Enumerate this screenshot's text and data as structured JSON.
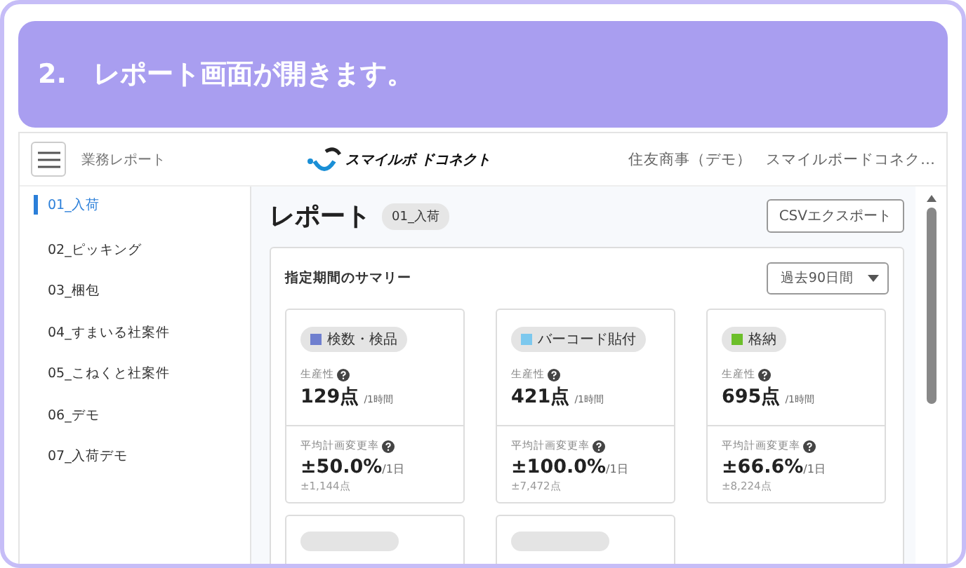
{
  "banner": {
    "text": "2.　レポート画面が開きます。"
  },
  "header": {
    "title": "業務レポート",
    "logo_text": "スマイルボ ドコネクト",
    "company": "住友商事（デモ）",
    "user": "スマイルボードコネク…"
  },
  "sidebar": {
    "items": [
      {
        "label": "01_入荷",
        "selected": true
      },
      {
        "label": "02_ピッキング",
        "selected": false
      },
      {
        "label": "03_梱包",
        "selected": false
      },
      {
        "label": "04_すまいる社案件",
        "selected": false
      },
      {
        "label": "05_こねくと社案件",
        "selected": false
      },
      {
        "label": "06_デモ",
        "selected": false
      },
      {
        "label": "07_入荷デモ",
        "selected": false
      }
    ]
  },
  "report": {
    "title": "レポート",
    "tag": "01_入荷",
    "export_button": "CSVエクスポート"
  },
  "summary": {
    "title": "指定期間のサマリー",
    "period": "過去90日間",
    "cards": [
      {
        "name": "検数・検品",
        "color": "#6f7fcf",
        "productivity_label": "生産性",
        "productivity": "129点",
        "productivity_unit": "/1時間",
        "rate_label": "平均計画変更率",
        "rate": "±50.0%",
        "rate_unit": "/1日",
        "note": "±1,144点"
      },
      {
        "name": "バーコード貼付",
        "color": "#7cc8ee",
        "productivity_label": "生産性",
        "productivity": "421点",
        "productivity_unit": "/1時間",
        "rate_label": "平均計画変更率",
        "rate": "±100.0%",
        "rate_unit": "/1日",
        "note": "±7,472点"
      },
      {
        "name": "格納",
        "color": "#6cbf2a",
        "productivity_label": "生産性",
        "productivity": "695点",
        "productivity_unit": "/1時間",
        "rate_label": "平均計画変更率",
        "rate": "±66.6%",
        "rate_unit": "/1日",
        "note": "±8,224点"
      }
    ]
  }
}
